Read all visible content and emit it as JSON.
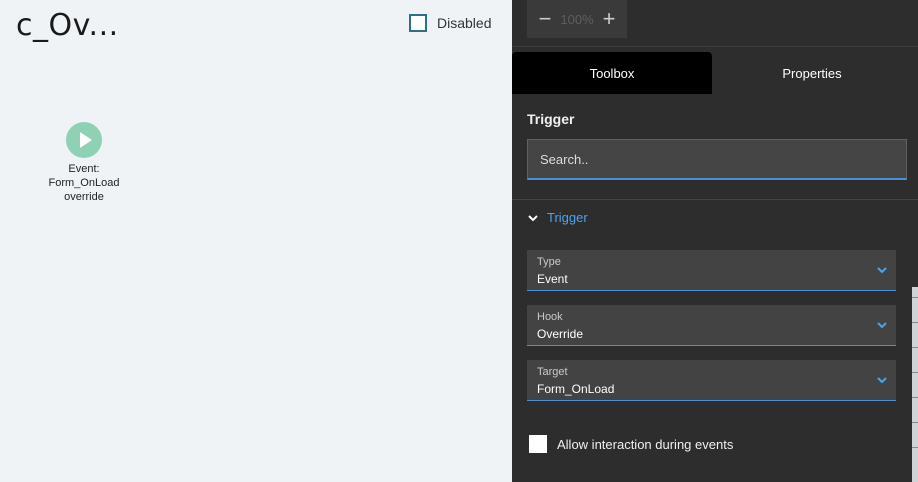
{
  "canvas": {
    "title": "c_Ov...",
    "disabled_label": "Disabled",
    "node": {
      "line1": "Event:",
      "line2": "Form_OnLoad",
      "line3": "override",
      "icon": "play-icon"
    }
  },
  "zoom": {
    "minus": "−",
    "value": "100%",
    "plus": "+"
  },
  "tabs": [
    {
      "label": "Toolbox"
    },
    {
      "label": "Properties"
    }
  ],
  "section": {
    "title": "Trigger",
    "search_placeholder": "Search.."
  },
  "accordion": {
    "label": "Trigger"
  },
  "fields": [
    {
      "label": "Type",
      "value": "Event"
    },
    {
      "label": "Hook",
      "value": "Override"
    },
    {
      "label": "Target",
      "value": "Form_OnLoad"
    }
  ],
  "allow_interaction_label": "Allow interaction during events",
  "colors": {
    "accent": "#4a90d9",
    "panel": "#2d2d2d",
    "node": "#8fd1b4"
  }
}
